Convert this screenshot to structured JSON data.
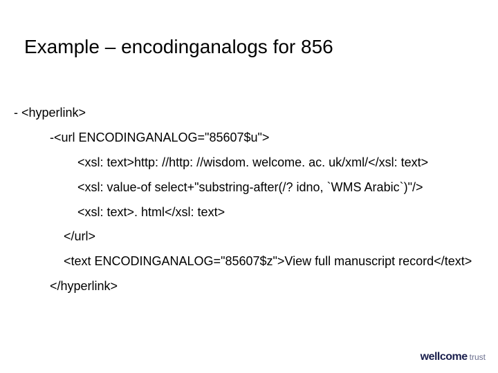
{
  "title": "Example – encodinganalogs for 856",
  "lines": {
    "l1": "- <hyperlink>",
    "l2": "-<url ENCODINGANALOG=\"85607$u\">",
    "l3": "<xsl: text>http: //http: //wisdom. welcome. ac. uk/xml/</xsl: text>",
    "l4": "<xsl: value-of select+\"substring-after(/? idno, `WMS Arabic`)\"/>",
    "l5": "<xsl: text>. html</xsl: text>",
    "l6": "</url>",
    "l7": "<text ENCODINGANALOG=\"85607$z\">View full manuscript record</text>",
    "l8": "</hyperlink>"
  },
  "logo": {
    "main": "wellcome",
    "sub": "trust"
  }
}
